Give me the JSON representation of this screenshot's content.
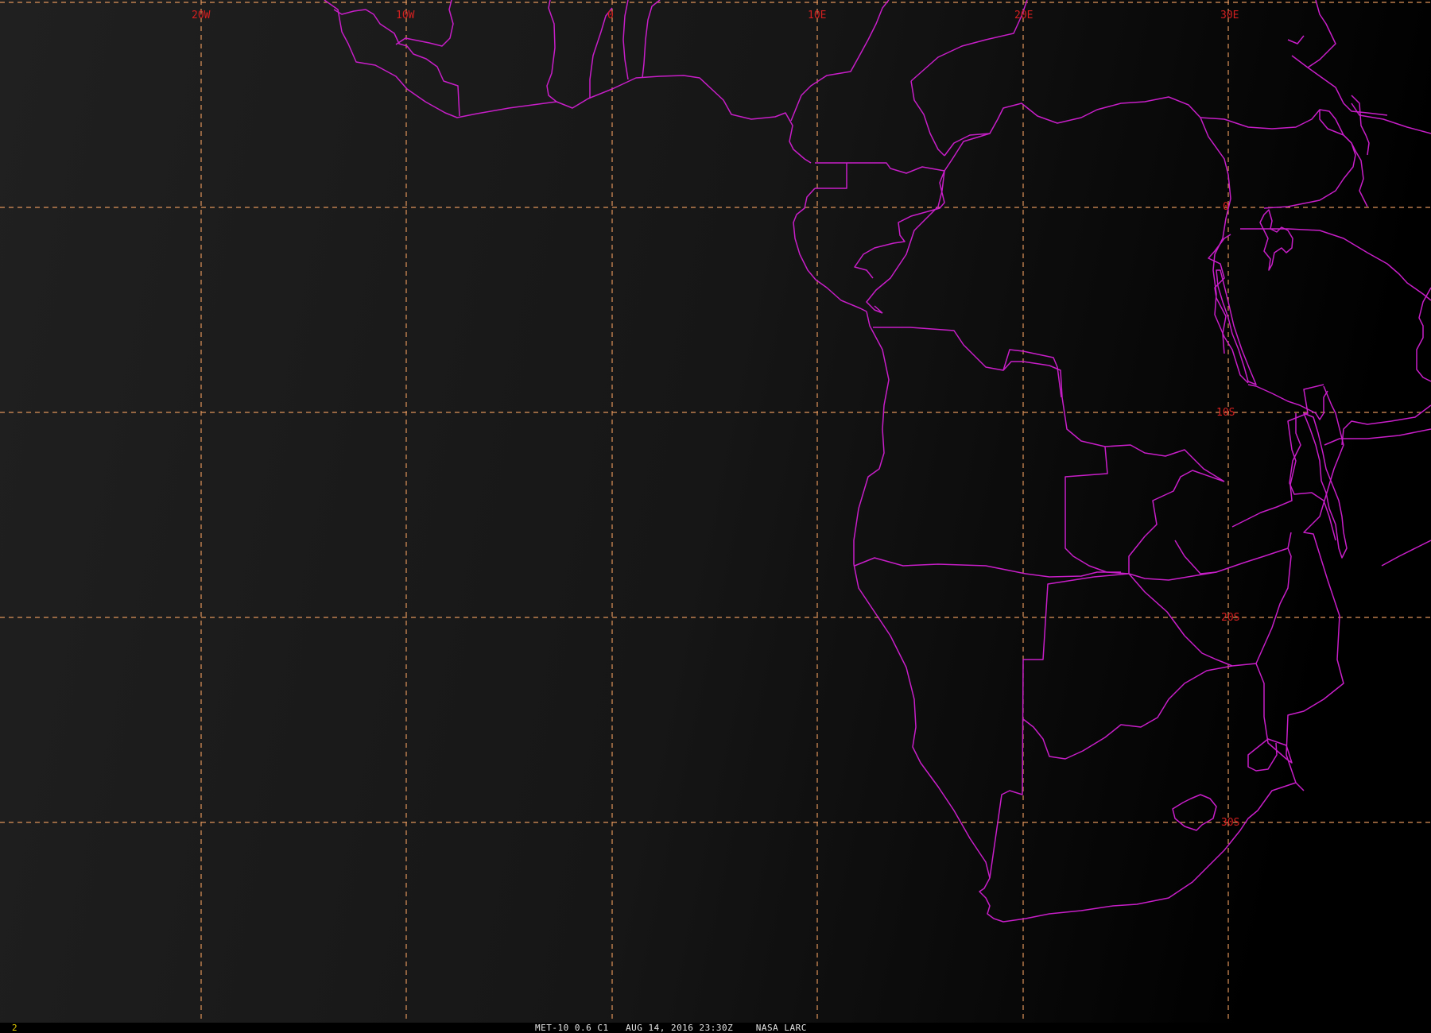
{
  "map": {
    "lon_labels": [
      "20W",
      "10W",
      "0",
      "10E",
      "20E",
      "30E"
    ],
    "lat_labels": [
      "0",
      "10S",
      "20S",
      "30S"
    ],
    "colors": {
      "background_dark": "#000000",
      "background_light": "#1e1e1e",
      "graticule": "#e0945a",
      "labels": "#d42020",
      "borders": "#c81ec8"
    }
  },
  "status_bar": {
    "frame_number": "2",
    "caption": "MET-10 0.6 C1   AUG 14, 2016 23:30Z    NASA LARC"
  }
}
